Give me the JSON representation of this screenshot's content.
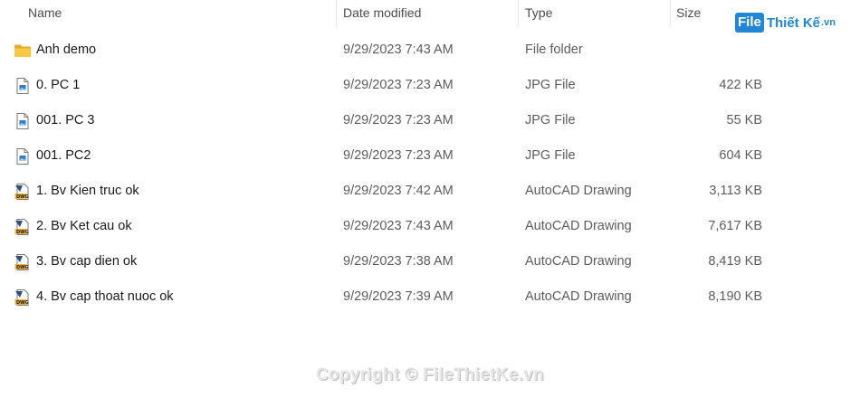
{
  "header": {
    "name": "Name",
    "date_modified": "Date modified",
    "type": "Type",
    "size": "Size"
  },
  "files": [
    {
      "name": "Anh demo",
      "date": "9/29/2023 7:43 AM",
      "type": "File folder",
      "size": "",
      "icon": "folder-icon"
    },
    {
      "name": "0. PC 1",
      "date": "9/29/2023 7:23 AM",
      "type": "JPG File",
      "size": "422 KB",
      "icon": "jpg-file-icon"
    },
    {
      "name": "001. PC 3",
      "date": "9/29/2023 7:23 AM",
      "type": "JPG File",
      "size": "55 KB",
      "icon": "jpg-file-icon"
    },
    {
      "name": "001. PC2",
      "date": "9/29/2023 7:23 AM",
      "type": "JPG File",
      "size": "604 KB",
      "icon": "jpg-file-icon"
    },
    {
      "name": "1. Bv Kien truc ok",
      "date": "9/29/2023 7:42 AM",
      "type": "AutoCAD Drawing",
      "size": "3,113 KB",
      "icon": "dwg-file-icon"
    },
    {
      "name": "2. Bv Ket cau ok",
      "date": "9/29/2023 7:43 AM",
      "type": "AutoCAD Drawing",
      "size": "7,617 KB",
      "icon": "dwg-file-icon"
    },
    {
      "name": "3. Bv cap dien ok",
      "date": "9/29/2023 7:38 AM",
      "type": "AutoCAD Drawing",
      "size": "8,419 KB",
      "icon": "dwg-file-icon"
    },
    {
      "name": "4. Bv cap thoat nuoc ok",
      "date": "9/29/2023 7:39 AM",
      "type": "AutoCAD Drawing",
      "size": "8,190 KB",
      "icon": "dwg-file-icon"
    }
  ],
  "watermark": {
    "logo_file": "File",
    "logo_brand": "Thiết Kế",
    "logo_tld": ".vn",
    "copyright": "Copyright © FileThietKe.vn"
  },
  "colors": {
    "folder": "#f8c846",
    "accent": "#1f86d8"
  }
}
